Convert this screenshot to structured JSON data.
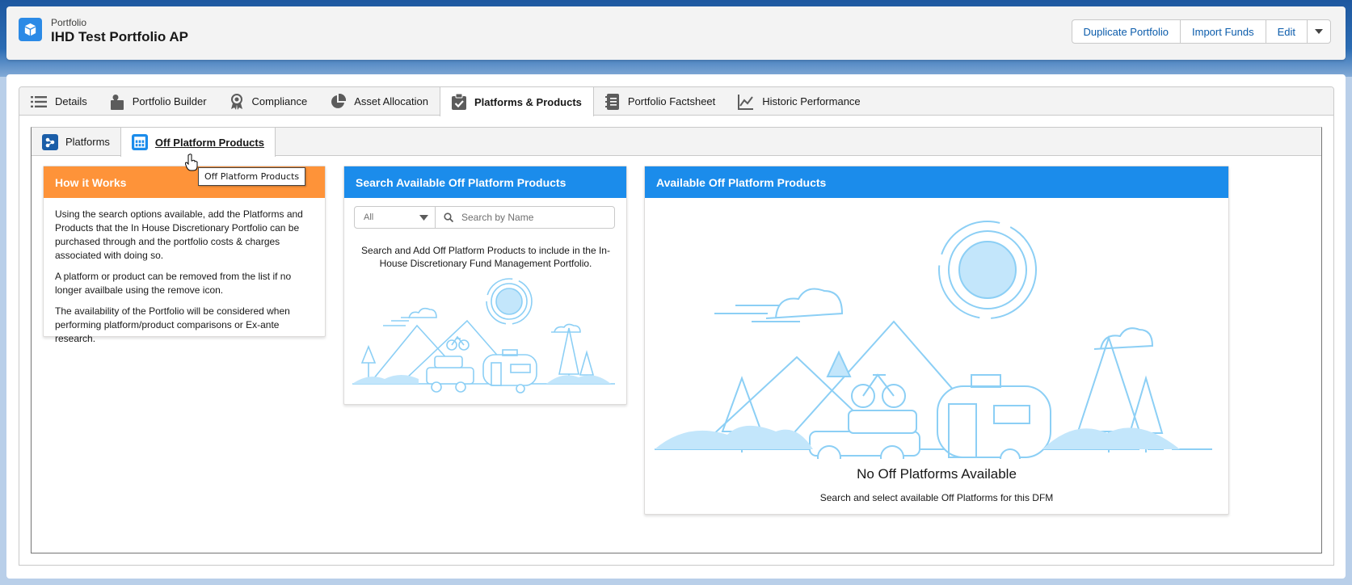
{
  "header": {
    "record_type": "Portfolio",
    "title": "IHD Test Portfolio AP",
    "buttons": {
      "duplicate": "Duplicate Portfolio",
      "import": "Import Funds",
      "edit": "Edit"
    }
  },
  "tabs": [
    {
      "label": "Details",
      "icon": "list-icon"
    },
    {
      "label": "Portfolio Builder",
      "icon": "puzzle-icon"
    },
    {
      "label": "Compliance",
      "icon": "award-icon"
    },
    {
      "label": "Asset Allocation",
      "icon": "pie-chart-icon"
    },
    {
      "label": "Platforms & Products",
      "icon": "clipboard-check-icon",
      "active": true
    },
    {
      "label": "Portfolio Factsheet",
      "icon": "notebook-icon"
    },
    {
      "label": "Historic Performance",
      "icon": "line-chart-icon"
    }
  ],
  "subtabs": [
    {
      "label": "Platforms",
      "icon": "platform-icon"
    },
    {
      "label": "Off Platform Products",
      "icon": "table-icon",
      "active": true
    }
  ],
  "tooltip": "Off Platform Products",
  "how_it_works": {
    "title": "How it Works",
    "paragraphs": [
      "Using the search options available, add the Platforms and Products that the In House Discretionary Portfolio can be purchased through and the portfolio costs & charges associated with doing so.",
      "A platform or product can be removed from the list if no longer availbale using the remove icon.",
      "The availability of the Portfolio will be considered when performing platform/product comparisons or Ex-ante research."
    ]
  },
  "search_panel": {
    "title": "Search Available Off Platform Products",
    "filter_value": "All",
    "search_placeholder": "Search by Name",
    "description": "Search and Add Off Platform Products to include in the In-House Discretionary Fund Management Portfolio."
  },
  "available_panel": {
    "title": "Available Off Platform Products",
    "empty_title": "No Off Platforms Available",
    "empty_subtitle": "Search and select available Off Platforms for this DFM"
  },
  "colors": {
    "brand_blue": "#1b8ceb",
    "orange": "#fe9339",
    "link": "#0b5cab",
    "illustration": "#8ccff5"
  }
}
